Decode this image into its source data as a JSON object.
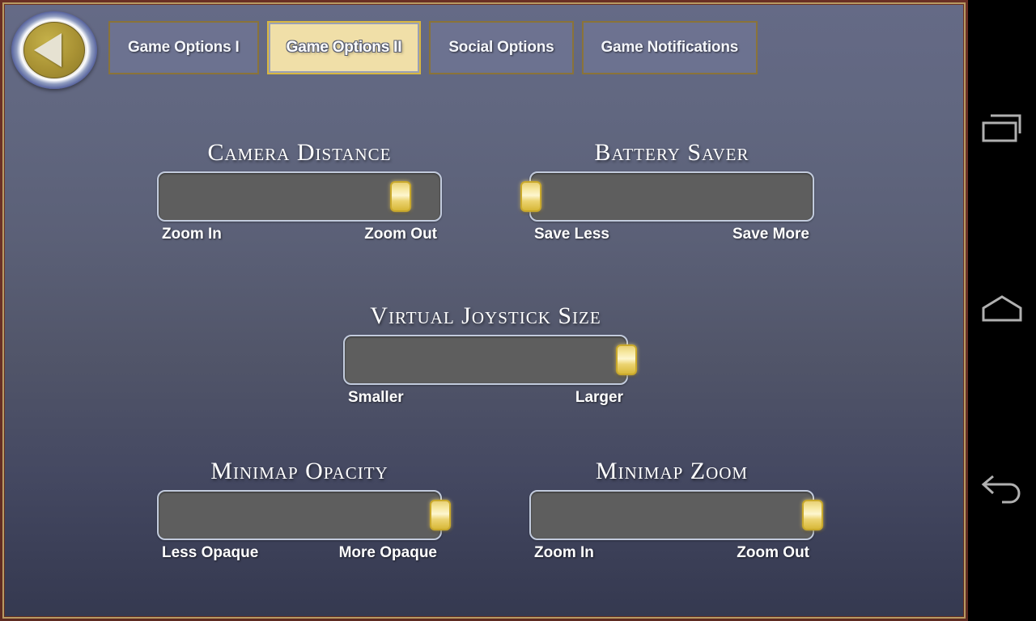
{
  "app": {
    "screen_title": "Game Options II"
  },
  "back_button": {
    "label": "Back",
    "icon": "left-triangle-icon"
  },
  "tabs": [
    {
      "label": "Game Options I",
      "active": false
    },
    {
      "label": "Game Options II",
      "active": true
    },
    {
      "label": "Social Options",
      "active": false
    },
    {
      "label": "Game Notifications",
      "active": false
    }
  ],
  "sliders": [
    {
      "title": "Camera Distance",
      "left_label": "Zoom In",
      "right_label": "Zoom Out",
      "value_percent": 86
    },
    {
      "title": "Battery Saver",
      "left_label": "Save Less",
      "right_label": "Save More",
      "value_percent": 0
    },
    {
      "title": "Virtual Joystick Size",
      "left_label": "Smaller",
      "right_label": "Larger",
      "value_percent": 100
    },
    {
      "title": "Minimap Opacity",
      "left_label": "Less Opaque",
      "right_label": "More Opaque",
      "value_percent": 100
    },
    {
      "title": "Minimap Zoom",
      "left_label": "Zoom In",
      "right_label": "Zoom Out",
      "value_percent": 100
    }
  ],
  "nav_bar": {
    "recents_label": "Recent apps",
    "home_label": "Home",
    "back_label": "Back",
    "icons": [
      "recents-icon",
      "home-icon",
      "back-arrow-icon"
    ]
  },
  "colors": {
    "frame_border": "#6b3228",
    "frame_inner_line": "#b79a63",
    "panel_top": "#656a86",
    "panel_bottom": "#353950",
    "tab_border": "#8a7339",
    "tab_active_bg": "#f0dfa8",
    "tab_active_border": "#d8b740",
    "track_fill": "#5e5e5e",
    "track_border": "#c2cbdd",
    "thumb_gold": "#f6e79e",
    "text_white": "#ffffff",
    "nav_bar_bg": "#000000",
    "nav_icon": "#b0b0b0"
  }
}
